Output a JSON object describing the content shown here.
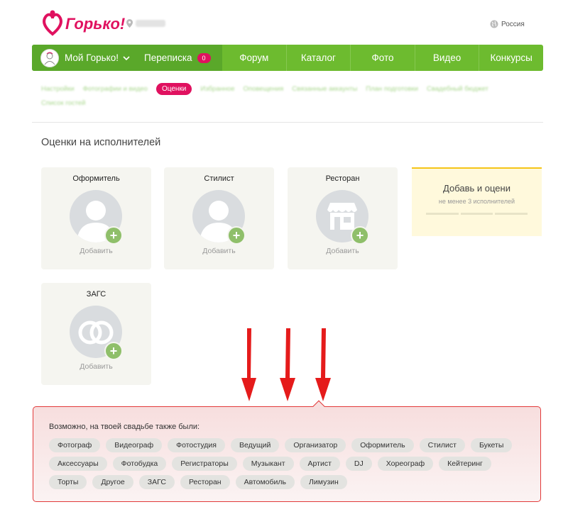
{
  "header": {
    "logo_text": "Горько!",
    "region": "Россия"
  },
  "nav": {
    "my_label": "Мой Горько!",
    "messages_label": "Переписка",
    "messages_count": "0",
    "items": [
      "Форум",
      "Каталог",
      "Фото",
      "Видео",
      "Конкурсы"
    ]
  },
  "subnav": {
    "before": [
      "Настройки",
      "Фотографии и видео"
    ],
    "active": "Оценки",
    "after": [
      "Избранное",
      "Оповещения",
      "Связанные аккаунты",
      "План подготовки",
      "Свадебный бюджет",
      "Список гостей"
    ]
  },
  "section_title": "Оценки на исполнителей",
  "cards": [
    {
      "title": "Оформитель",
      "add_label": "Добавить",
      "icon": "person-placeholder-icon"
    },
    {
      "title": "Стилист",
      "add_label": "Добавить",
      "icon": "person-placeholder-icon"
    },
    {
      "title": "Ресторан",
      "add_label": "Добавить",
      "icon": "restaurant-icon"
    },
    {
      "title": "ЗАГС",
      "add_label": "Добавить",
      "icon": "rings-icon"
    }
  ],
  "promo": {
    "title": "Добавь и оцени",
    "subtitle": "не менее 3 исполнителей"
  },
  "suggest": {
    "title": "Возможно, на твоей свадьбе также были:",
    "rows": [
      [
        "Фотограф",
        "Видеограф",
        "Фотостудия",
        "Ведущий",
        "Организатор",
        "Оформитель",
        "Стилист",
        "Букеты"
      ],
      [
        "Аксессуары",
        "Фотобудка",
        "Регистраторы",
        "Музыкант",
        "Артист",
        "DJ",
        "Хореограф",
        "Кейтеринг"
      ],
      [
        "Торты",
        "Другое",
        "ЗАГС",
        "Ресторан",
        "Автомобиль",
        "Лимузин"
      ]
    ]
  },
  "colors": {
    "brand_pink": "#e0115f",
    "nav_green": "#6dbb2f",
    "highlight_red": "#e23a3a"
  }
}
